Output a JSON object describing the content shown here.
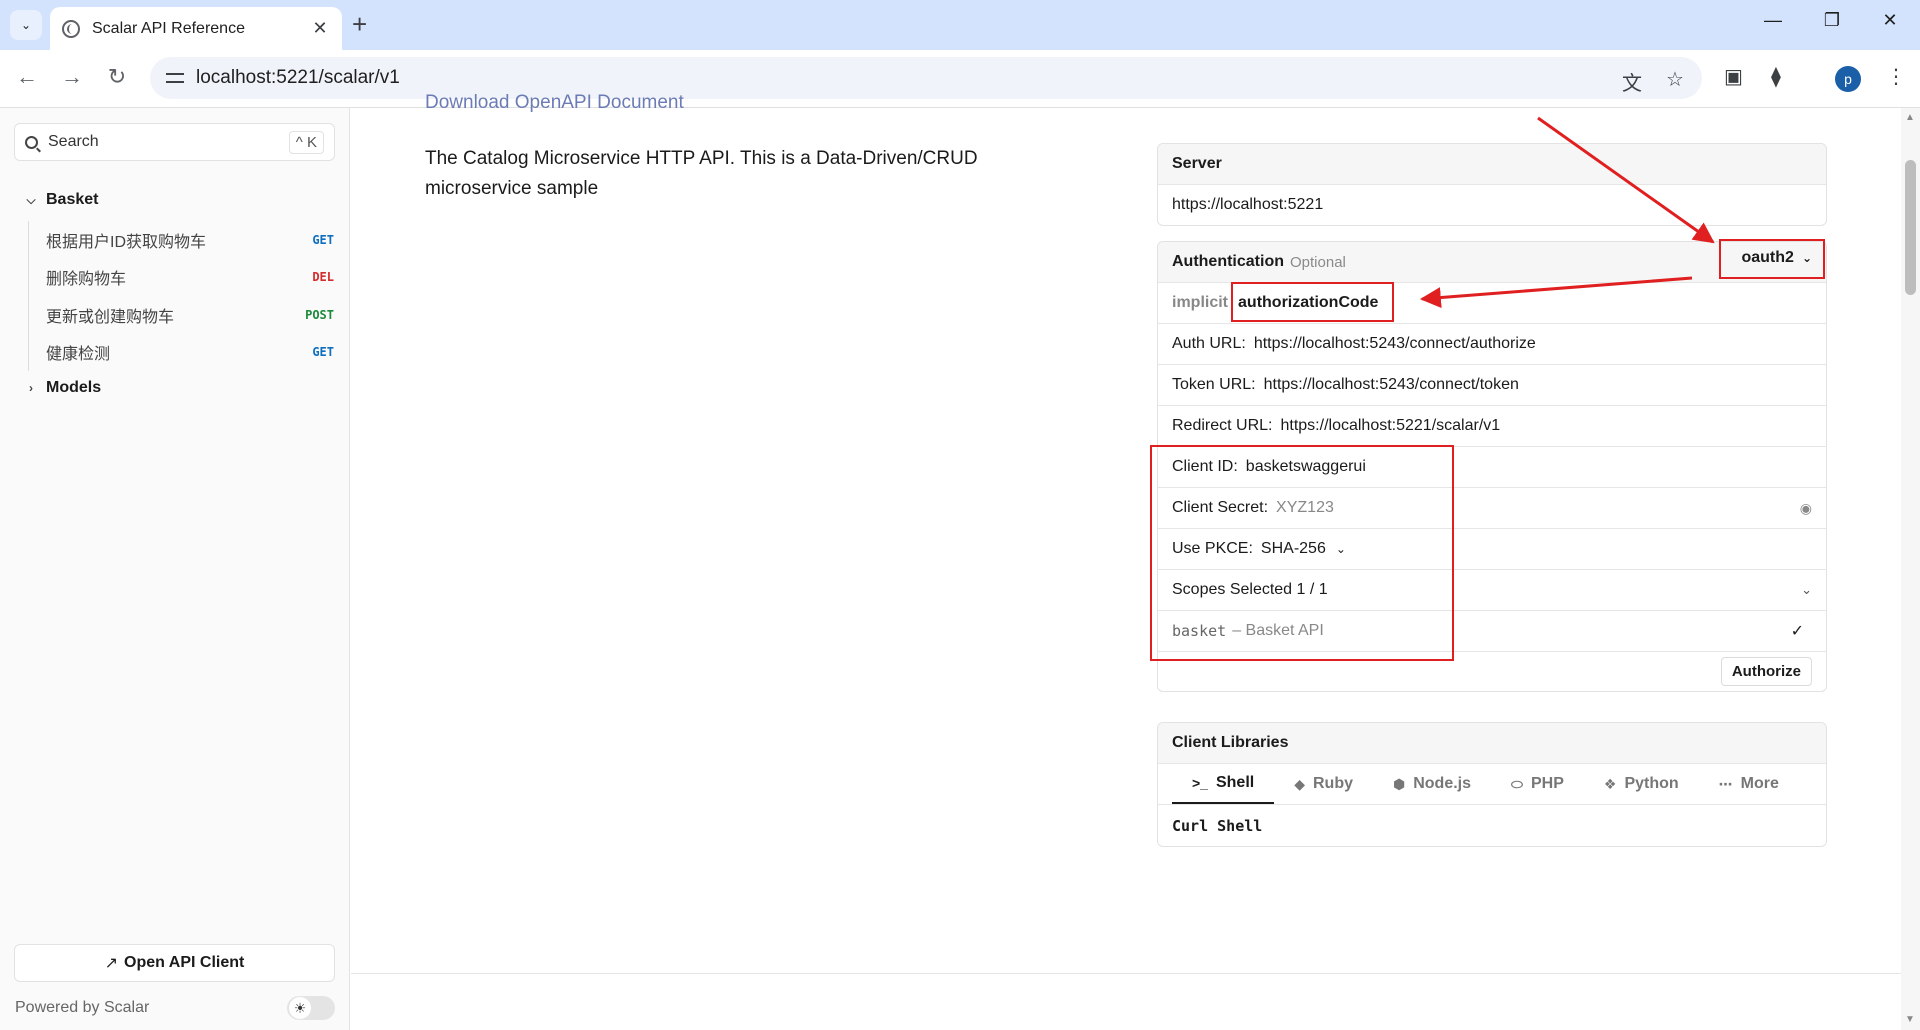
{
  "browser": {
    "tab_title": "Scalar API Reference",
    "url": "localhost:5221/scalar/v1",
    "profile_initial": "p"
  },
  "sidebar": {
    "search_label": "Search",
    "search_shortcut": "^ K",
    "groups": [
      {
        "label": "Basket",
        "expanded": true
      },
      {
        "label": "Models",
        "expanded": false
      }
    ],
    "items": [
      {
        "label": "根据用户ID获取购物车",
        "method": "GET"
      },
      {
        "label": "删除购物车",
        "method": "DEL"
      },
      {
        "label": "更新或创建购物车",
        "method": "POST"
      },
      {
        "label": "健康检测",
        "method": "GET"
      }
    ],
    "open_client_label": "Open API Client",
    "powered_by": "Powered by Scalar"
  },
  "content": {
    "download_link": "Download OpenAPI Document",
    "description": "The Catalog Microservice HTTP API. This is a Data-Driven/CRUD microservice sample"
  },
  "server": {
    "title": "Server",
    "url": "https://localhost:5221"
  },
  "auth": {
    "title": "Authentication",
    "optional_label": "Optional",
    "selected_scheme": "oauth2",
    "flows": [
      "implicit",
      "authorizationCode"
    ],
    "active_flow": "authorizationCode",
    "auth_url_label": "Auth URL:",
    "auth_url": "https://localhost:5243/connect/authorize",
    "token_url_label": "Token URL:",
    "token_url": "https://localhost:5243/connect/token",
    "redirect_url_label": "Redirect URL:",
    "redirect_url": "https://localhost:5221/scalar/v1",
    "client_id_label": "Client ID:",
    "client_id": "basketswaggerui",
    "client_secret_label": "Client Secret:",
    "client_secret_placeholder": "XYZ123",
    "pkce_label": "Use PKCE:",
    "pkce_value": "SHA-256",
    "scopes_label": "Scopes Selected 1 / 1",
    "scope_name": "basket",
    "scope_desc": "– Basket API",
    "authorize_label": "Authorize"
  },
  "client_libraries": {
    "title": "Client Libraries",
    "tabs": [
      "Shell",
      "Ruby",
      "Node.js",
      "PHP",
      "Python",
      "More"
    ],
    "active_tab": "Shell",
    "snippet_title": "Curl Shell"
  },
  "colors": {
    "annotation_red": "#e02020",
    "get": "#0f6fbf",
    "delete": "#d42c2c",
    "post": "#1c8a3c"
  }
}
